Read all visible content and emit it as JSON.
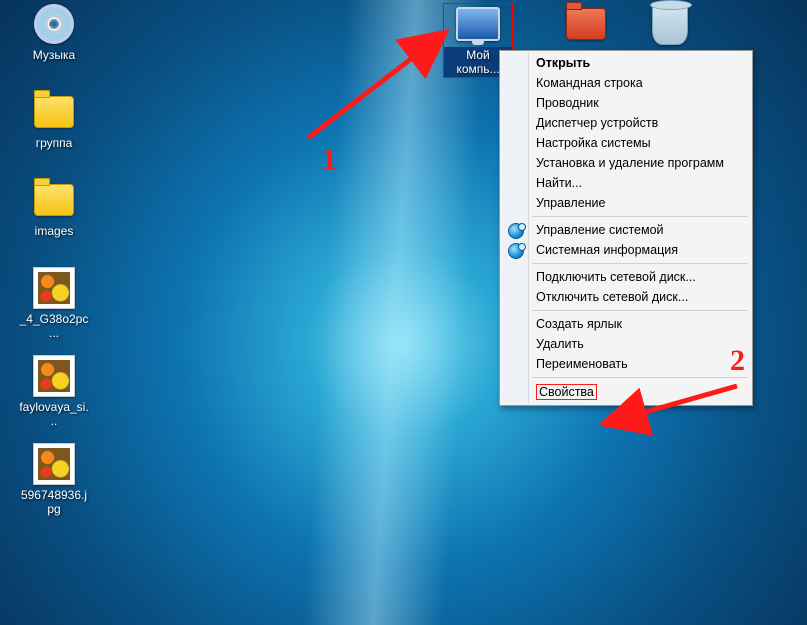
{
  "desktop_icons": {
    "music": {
      "label": "Музыка"
    },
    "group": {
      "label": "группа"
    },
    "images": {
      "label": "images"
    },
    "thumb1": {
      "label": "_4_G38o2pc..."
    },
    "thumb2": {
      "label": "faylovaya_si..."
    },
    "thumb3": {
      "label": "596748936.jpg"
    },
    "mycomputer": {
      "label": "Мой компь..."
    },
    "redfolder": {
      "label": ""
    },
    "recyclebin": {
      "label": ""
    }
  },
  "context_menu": {
    "open": "Открыть",
    "cmd": "Командная строка",
    "explorer": "Проводник",
    "devmgr": "Диспетчер устройств",
    "sysconfig": "Настройка системы",
    "programs": "Установка и удаление программ",
    "find": "Найти...",
    "manage": "Управление",
    "sysmanage": "Управление системой",
    "sysinfo": "Системная информация",
    "mapdrive": "Подключить сетевой диск...",
    "unmapdrive": "Отключить сетевой диск...",
    "shortcut": "Создать ярлык",
    "delete": "Удалить",
    "rename": "Переименовать",
    "properties": "Свойства"
  },
  "annotations": {
    "num1": "1",
    "num2": "2"
  }
}
